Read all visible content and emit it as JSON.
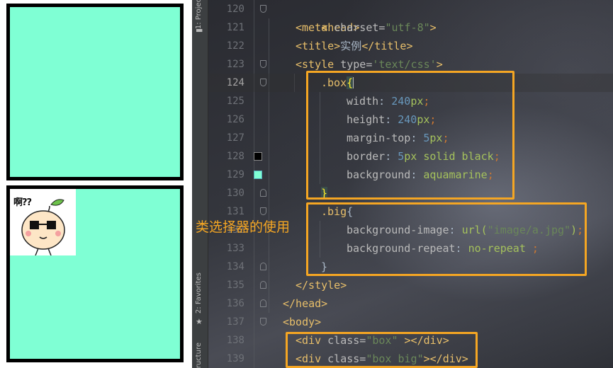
{
  "preview": {
    "box_color": "#7fffd4",
    "border_color": "#000000",
    "image_text": "啊??"
  },
  "sidebar": {
    "project_label": "1: Project",
    "favorites_label": "2: Favorites",
    "structure_label": "Structure"
  },
  "editor": {
    "lines": [
      120,
      121,
      122,
      123,
      124,
      125,
      126,
      127,
      128,
      129,
      130,
      131,
      132,
      133,
      134,
      135,
      136,
      137,
      138,
      139
    ],
    "active_line": 124,
    "swatches": {
      "line128": "#000000",
      "line129": "#7fffd4"
    }
  },
  "code": {
    "l120_tag": "<head>",
    "l121_open": "<meta ",
    "l121_attr": "charset=",
    "l121_str": "\"utf-8\"",
    "l121_close": ">",
    "l122_open": "<title>",
    "l122_text": "实例",
    "l122_close": "</title>",
    "l123_open": "<style ",
    "l123_attr": "type=",
    "l123_str": "'text/css'",
    "l123_close": ">",
    "l124_sel": ".box",
    "l124_brace": "{",
    "l125_prop": "width",
    "l125_colon": ": ",
    "l125_num": "240",
    "l125_unit": "px",
    "l125_semi": ";",
    "l126_prop": "height",
    "l126_colon": ": ",
    "l126_num": "240",
    "l126_unit": "px",
    "l126_semi": ";",
    "l127_prop": "margin-top",
    "l127_colon": ": ",
    "l127_num": "5",
    "l127_unit": "px",
    "l127_semi": ";",
    "l128_prop": "border",
    "l128_colon": ": ",
    "l128_num": "5",
    "l128_unit": "px solid black",
    "l128_semi": ";",
    "l129_prop": "background",
    "l129_colon": ": ",
    "l129_val": "aquamarine",
    "l129_semi": ";",
    "l130_brace": "}",
    "l131_sel": ".big",
    "l131_brace": "{",
    "l132_prop": "background-image",
    "l132_colon": ": ",
    "l132_fn": "url(",
    "l132_str": "\"image/a.jpg\"",
    "l132_fnclose": ")",
    "l132_semi": ";",
    "l133_prop": "background-repeat",
    "l133_colon": ": ",
    "l133_val": "no-repeat",
    "l133_semi": " ;",
    "l134_brace": "}",
    "l135_tag": "</style>",
    "l136_tag": "</head>",
    "l137_tag": "<body>",
    "l138_open": "<div ",
    "l138_attr": "class=",
    "l138_str": "\"box\"",
    "l138_close": " ></div>",
    "l139_open": "<div ",
    "l139_attr": "class=",
    "l139_str": "\"box big\"",
    "l139_close": "></div>"
  },
  "annotation": {
    "text": "类选择器的使用",
    "color": "#f5a623"
  }
}
